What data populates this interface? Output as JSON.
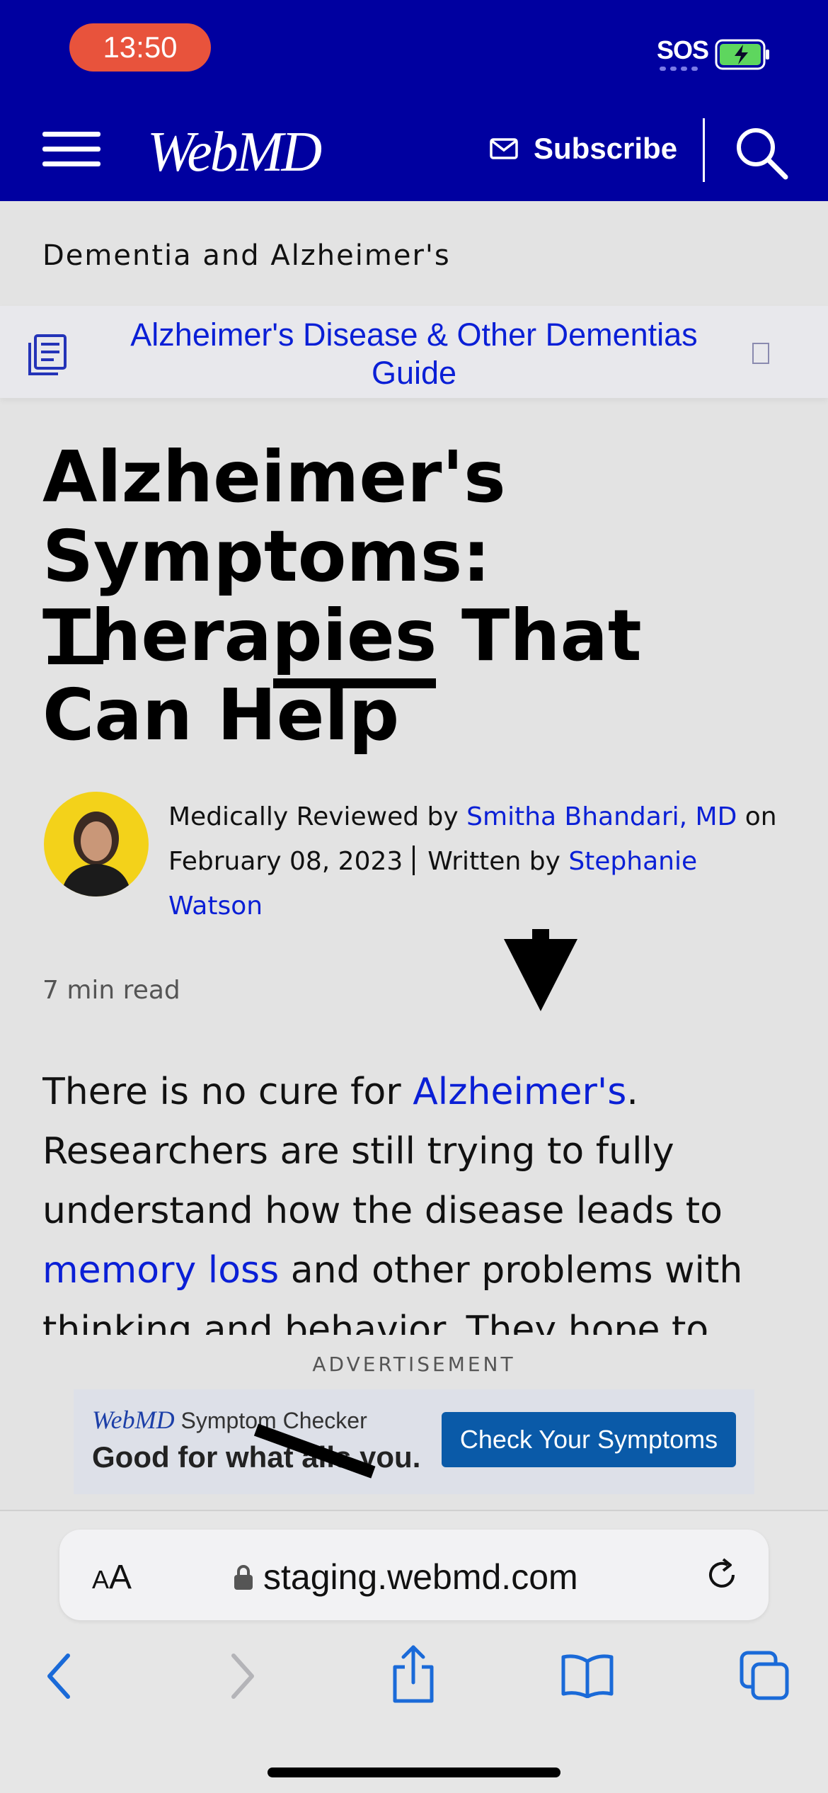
{
  "status_bar": {
    "time": "13:50",
    "sos": "SOS",
    "battery": "charging"
  },
  "header": {
    "logo": "WebMD",
    "subscribe_label": "Subscribe",
    "menu_icon": "hamburger-icon",
    "search_icon": "search-icon",
    "mail_icon": "envelope-icon"
  },
  "breadcrumb": {
    "category": "Dementia and Alzheimer's"
  },
  "guide": {
    "label": "Alzheimer's Disease & Other Dementias Guide",
    "icon": "guide-list-icon"
  },
  "article": {
    "title": "Alzheimer's Symptoms: Therapies That Can Help",
    "byline": {
      "reviewed_prefix": "Medically Reviewed by ",
      "reviewer": "Smitha Bhandari, MD",
      "reviewed_on": " on",
      "date": "February 08, 2023",
      "written_prefix": "Written by ",
      "author": "Stephanie Watson"
    },
    "read_time": "7 min read",
    "body": {
      "p1_a": "There is no cure for ",
      "p1_link1": "Alzheimer's",
      "p1_b": ". Researchers are still trying to fully understand how the disease leads to ",
      "p1_link2": "memory loss",
      "p1_c": " and other problems with thinking and behavior. They hope to"
    }
  },
  "advertisement": {
    "label": "ADVERTISEMENT",
    "brand_prefix": "WebMD",
    "brand_suffix": " Symptom Checker",
    "tagline": "Good for what ails you.",
    "cta": "Check Your Symptoms"
  },
  "browser": {
    "text_size_small": "A",
    "text_size_large": "A",
    "url": "staging.webmd.com",
    "colors": {
      "toolbar_active": "#1a6ad8",
      "toolbar_disabled": "#b4b4b8"
    }
  },
  "colors": {
    "header_bg": "#0000a0",
    "link": "#0a1fd6",
    "time_pill": "#e8533c",
    "page_bg": "#e3e3e3"
  }
}
